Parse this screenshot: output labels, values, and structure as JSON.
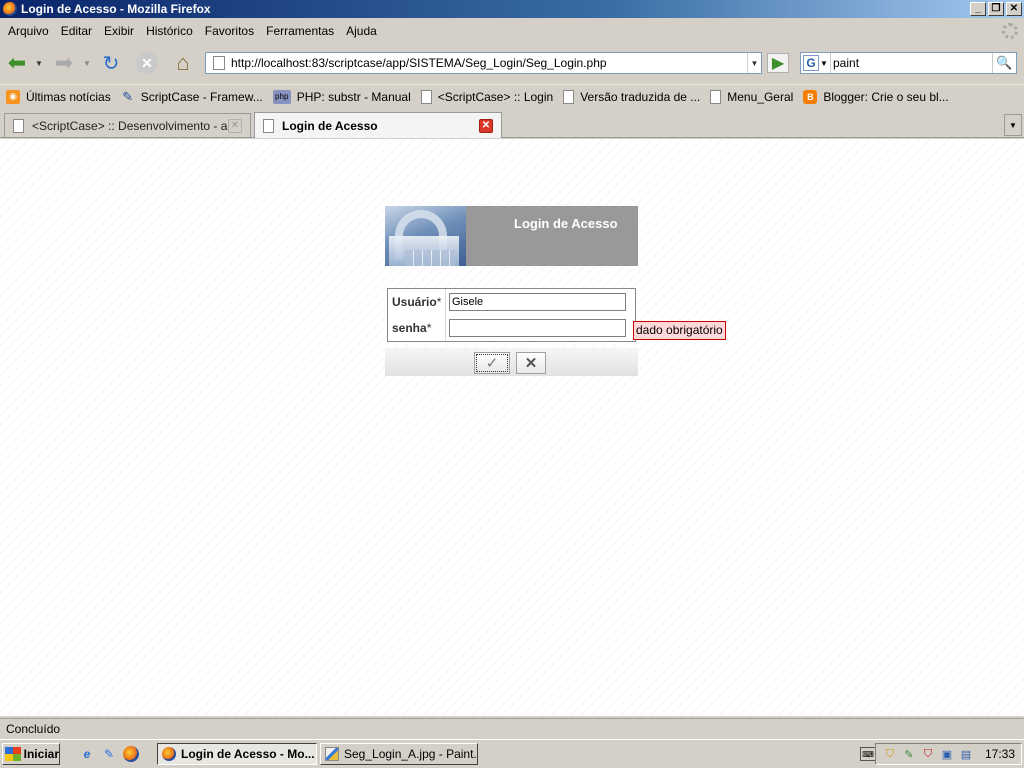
{
  "window": {
    "title": "Login de Acesso - Mozilla Firefox",
    "controls": {
      "minimize": "_",
      "maximize": "❐",
      "close": "✕"
    }
  },
  "menu": [
    "Arquivo",
    "Editar",
    "Exibir",
    "Histórico",
    "Favoritos",
    "Ferramentas",
    "Ajuda"
  ],
  "navigation": {
    "url": "http://localhost:83/scriptcase/app/SISTEMA/Seg_Login/Seg_Login.php",
    "search_engine_icon": "G",
    "search_value": "paint"
  },
  "bookmarks": [
    {
      "label": "Últimas notícias",
      "icon": "rss-icon"
    },
    {
      "label": "ScriptCase - Framew...",
      "icon": "scriptcase-icon"
    },
    {
      "label": "PHP: substr - Manual",
      "icon": "php-icon"
    },
    {
      "label": "<ScriptCase> :: Login",
      "icon": "page-icon"
    },
    {
      "label": "Versão traduzida de ...",
      "icon": "page-icon"
    },
    {
      "label": "Menu_Geral",
      "icon": "page-icon"
    },
    {
      "label": "Blogger: Crie o seu bl...",
      "icon": "blogger-icon"
    }
  ],
  "tabs": [
    {
      "label": "<ScriptCase> :: Desenvolvimento - a...",
      "active": false
    },
    {
      "label": "Login de Acesso",
      "active": true
    }
  ],
  "login": {
    "header_title": "Login de Acesso",
    "user_label": "Usuário",
    "password_label": "senha",
    "required_marker": "*",
    "user_value": "Gisele",
    "password_value": "",
    "error_text": "dado obrigatório",
    "ok_icon": "✓",
    "cancel_icon": "✕"
  },
  "status": "Concluído",
  "taskbar": {
    "start_label": "Iniciar",
    "windows": [
      {
        "label": "Login de Acesso - Mo...",
        "active": true
      },
      {
        "label": "Seg_Login_A.jpg - Paint....",
        "active": false
      }
    ],
    "clock": "17:33"
  }
}
